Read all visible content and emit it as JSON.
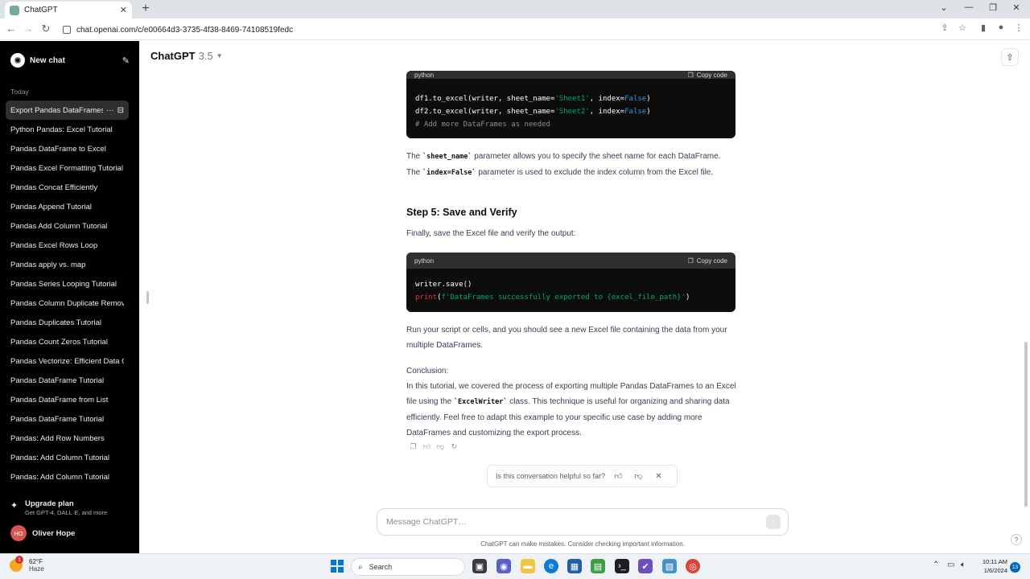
{
  "browser": {
    "tab_title": "ChatGPT",
    "url": "chat.openai.com/c/e00664d3-3735-4f38-8469-74108519fedc"
  },
  "sidebar": {
    "new_chat": "New chat",
    "section_label": "Today",
    "items": [
      {
        "label": "Export Pandas DataFrames"
      },
      {
        "label": "Python Pandas: Excel Tutorial"
      },
      {
        "label": "Pandas DataFrame to Excel"
      },
      {
        "label": "Pandas Excel Formatting Tutorial"
      },
      {
        "label": "Pandas Concat Efficiently"
      },
      {
        "label": "Pandas Append Tutorial"
      },
      {
        "label": "Pandas Add Column Tutorial"
      },
      {
        "label": "Pandas Excel Rows Loop"
      },
      {
        "label": "Pandas apply vs. map"
      },
      {
        "label": "Pandas Series Looping Tutorial"
      },
      {
        "label": "Pandas Column Duplicate Removal"
      },
      {
        "label": "Pandas Duplicates Tutorial"
      },
      {
        "label": "Pandas Count Zeros Tutorial"
      },
      {
        "label": "Pandas Vectorize: Efficient Data Ops"
      },
      {
        "label": "Pandas DataFrame Tutorial"
      },
      {
        "label": "Pandas DataFrame from List"
      },
      {
        "label": "Pandas DataFrame Tutorial"
      },
      {
        "label": "Pandas: Add Row Numbers"
      },
      {
        "label": "Pandas: Add Column Tutorial"
      },
      {
        "label": "Pandas: Add Column Tutorial"
      }
    ],
    "upgrade_title": "Upgrade plan",
    "upgrade_sub": "Get GPT-4, DALL·E, and more",
    "user_initials": "HO",
    "user_name": "Oliver Hope"
  },
  "header": {
    "model_name": "ChatGPT",
    "model_version": "3.5"
  },
  "code1": {
    "lang": "python",
    "copy_label": "Copy code",
    "l1_a": "df1.to_excel(writer, sheet_name=",
    "l1_str": "'Sheet1'",
    "l1_b": ", index=",
    "l1_kw": "False",
    "l1_c": ")",
    "l2_a": "df2.to_excel(writer, sheet_name=",
    "l2_str": "'Sheet2'",
    "l2_b": ", index=",
    "l2_kw": "False",
    "l2_c": ")",
    "l3_comment": "# Add more DataFrames as needed"
  },
  "para1": {
    "a": "The ",
    "code1": "`sheet_name`",
    "b": " parameter allows you to specify the sheet name for each DataFrame. The ",
    "code2": "`index=False`",
    "c": " parameter is used to exclude the index column from the Excel file."
  },
  "step5_heading": "Step 5: Save and Verify",
  "step5_text": "Finally, save the Excel file and verify the output:",
  "code2": {
    "lang": "python",
    "copy_label": "Copy code",
    "l1": "writer.save()",
    "l2_fn": "print",
    "l2_a": "(",
    "l2_str": "f'DataFrames successfully exported to {excel_file_path}'",
    "l2_b": ")"
  },
  "para_run": "Run your script or cells, and you should see a new Excel file containing the data from your multiple DataFrames.",
  "conclusion_label": "Conclusion:",
  "conclusion": {
    "a": "In this tutorial, we covered the process of exporting multiple Pandas DataFrames to an Excel file using the ",
    "code": "`ExcelWriter`",
    "b": " class. This technique is useful for organizing and sharing data efficiently. Feel free to adapt this example to your specific use case by adding more DataFrames and customizing the export process."
  },
  "feedback": {
    "question": "Is this conversation helpful so far?"
  },
  "composer": {
    "placeholder": "Message ChatGPT…"
  },
  "disclaimer": "ChatGPT can make mistakes. Consider checking important information.",
  "taskbar": {
    "temp": "62°F",
    "weather": "Haze",
    "weather_badge": "1",
    "search_label": "Search",
    "time": "10:11 AM",
    "date": "1/6/2024",
    "notif_count": "13"
  }
}
